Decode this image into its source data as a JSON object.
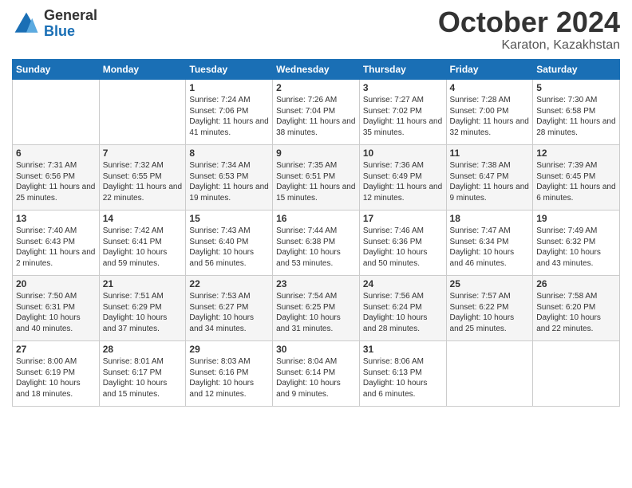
{
  "header": {
    "logo_general": "General",
    "logo_blue": "Blue",
    "title": "October 2024",
    "location": "Karaton, Kazakhstan"
  },
  "weekdays": [
    "Sunday",
    "Monday",
    "Tuesday",
    "Wednesday",
    "Thursday",
    "Friday",
    "Saturday"
  ],
  "weeks": [
    [
      {
        "day": "",
        "content": ""
      },
      {
        "day": "",
        "content": ""
      },
      {
        "day": "1",
        "content": "Sunrise: 7:24 AM\nSunset: 7:06 PM\nDaylight: 11 hours and 41 minutes."
      },
      {
        "day": "2",
        "content": "Sunrise: 7:26 AM\nSunset: 7:04 PM\nDaylight: 11 hours and 38 minutes."
      },
      {
        "day": "3",
        "content": "Sunrise: 7:27 AM\nSunset: 7:02 PM\nDaylight: 11 hours and 35 minutes."
      },
      {
        "day": "4",
        "content": "Sunrise: 7:28 AM\nSunset: 7:00 PM\nDaylight: 11 hours and 32 minutes."
      },
      {
        "day": "5",
        "content": "Sunrise: 7:30 AM\nSunset: 6:58 PM\nDaylight: 11 hours and 28 minutes."
      }
    ],
    [
      {
        "day": "6",
        "content": "Sunrise: 7:31 AM\nSunset: 6:56 PM\nDaylight: 11 hours and 25 minutes."
      },
      {
        "day": "7",
        "content": "Sunrise: 7:32 AM\nSunset: 6:55 PM\nDaylight: 11 hours and 22 minutes."
      },
      {
        "day": "8",
        "content": "Sunrise: 7:34 AM\nSunset: 6:53 PM\nDaylight: 11 hours and 19 minutes."
      },
      {
        "day": "9",
        "content": "Sunrise: 7:35 AM\nSunset: 6:51 PM\nDaylight: 11 hours and 15 minutes."
      },
      {
        "day": "10",
        "content": "Sunrise: 7:36 AM\nSunset: 6:49 PM\nDaylight: 11 hours and 12 minutes."
      },
      {
        "day": "11",
        "content": "Sunrise: 7:38 AM\nSunset: 6:47 PM\nDaylight: 11 hours and 9 minutes."
      },
      {
        "day": "12",
        "content": "Sunrise: 7:39 AM\nSunset: 6:45 PM\nDaylight: 11 hours and 6 minutes."
      }
    ],
    [
      {
        "day": "13",
        "content": "Sunrise: 7:40 AM\nSunset: 6:43 PM\nDaylight: 11 hours and 2 minutes."
      },
      {
        "day": "14",
        "content": "Sunrise: 7:42 AM\nSunset: 6:41 PM\nDaylight: 10 hours and 59 minutes."
      },
      {
        "day": "15",
        "content": "Sunrise: 7:43 AM\nSunset: 6:40 PM\nDaylight: 10 hours and 56 minutes."
      },
      {
        "day": "16",
        "content": "Sunrise: 7:44 AM\nSunset: 6:38 PM\nDaylight: 10 hours and 53 minutes."
      },
      {
        "day": "17",
        "content": "Sunrise: 7:46 AM\nSunset: 6:36 PM\nDaylight: 10 hours and 50 minutes."
      },
      {
        "day": "18",
        "content": "Sunrise: 7:47 AM\nSunset: 6:34 PM\nDaylight: 10 hours and 46 minutes."
      },
      {
        "day": "19",
        "content": "Sunrise: 7:49 AM\nSunset: 6:32 PM\nDaylight: 10 hours and 43 minutes."
      }
    ],
    [
      {
        "day": "20",
        "content": "Sunrise: 7:50 AM\nSunset: 6:31 PM\nDaylight: 10 hours and 40 minutes."
      },
      {
        "day": "21",
        "content": "Sunrise: 7:51 AM\nSunset: 6:29 PM\nDaylight: 10 hours and 37 minutes."
      },
      {
        "day": "22",
        "content": "Sunrise: 7:53 AM\nSunset: 6:27 PM\nDaylight: 10 hours and 34 minutes."
      },
      {
        "day": "23",
        "content": "Sunrise: 7:54 AM\nSunset: 6:25 PM\nDaylight: 10 hours and 31 minutes."
      },
      {
        "day": "24",
        "content": "Sunrise: 7:56 AM\nSunset: 6:24 PM\nDaylight: 10 hours and 28 minutes."
      },
      {
        "day": "25",
        "content": "Sunrise: 7:57 AM\nSunset: 6:22 PM\nDaylight: 10 hours and 25 minutes."
      },
      {
        "day": "26",
        "content": "Sunrise: 7:58 AM\nSunset: 6:20 PM\nDaylight: 10 hours and 22 minutes."
      }
    ],
    [
      {
        "day": "27",
        "content": "Sunrise: 8:00 AM\nSunset: 6:19 PM\nDaylight: 10 hours and 18 minutes."
      },
      {
        "day": "28",
        "content": "Sunrise: 8:01 AM\nSunset: 6:17 PM\nDaylight: 10 hours and 15 minutes."
      },
      {
        "day": "29",
        "content": "Sunrise: 8:03 AM\nSunset: 6:16 PM\nDaylight: 10 hours and 12 minutes."
      },
      {
        "day": "30",
        "content": "Sunrise: 8:04 AM\nSunset: 6:14 PM\nDaylight: 10 hours and 9 minutes."
      },
      {
        "day": "31",
        "content": "Sunrise: 8:06 AM\nSunset: 6:13 PM\nDaylight: 10 hours and 6 minutes."
      },
      {
        "day": "",
        "content": ""
      },
      {
        "day": "",
        "content": ""
      }
    ]
  ]
}
